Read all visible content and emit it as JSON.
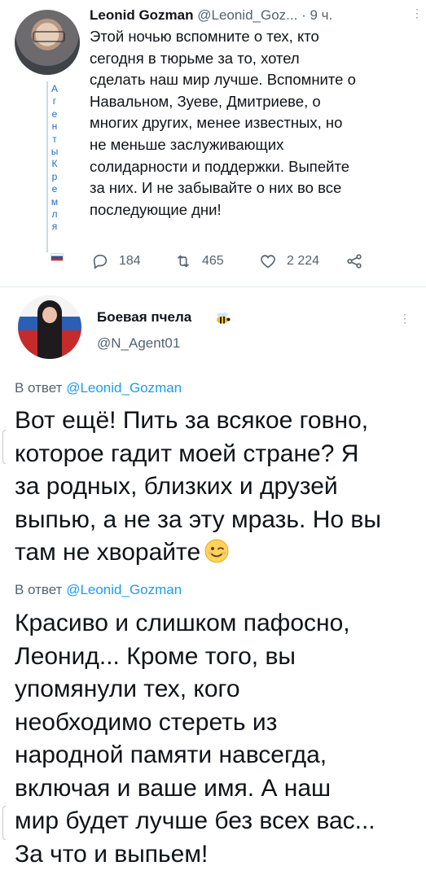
{
  "tweet1": {
    "author_name": "Leonid Gozman",
    "handle": "@Leonid_Goz...",
    "separator": "·",
    "time": "9 ч.",
    "text": "Этой ночью вспомните о тех, кто\nсегодня в тюрьме за то, хотел\nсделать наш мир лучше. Вспомните о\nНавальном, Зуеве, Дмитриеве, о\nмногих других, менее известных, но\nне меньше заслуживающих\nсолидарности и поддержки. Выпейте\nза них. И не забывайте о них во все\nпоследующие дни!",
    "side_label_letters": [
      "А",
      "г",
      "е",
      "н",
      "т",
      "ы",
      "К",
      "р",
      "е",
      "м",
      "л",
      "я"
    ],
    "replies": "184",
    "retweets": "465",
    "likes": "2 224"
  },
  "tweet2": {
    "author_name": "Боевая пчела",
    "handle": "@N_Agent01",
    "reply1_prefix": "В ответ",
    "reply1_mention": "@Leonid_Gozman",
    "reply1_text": "Вот ещё! Пить за всякое говно,\nкоторое гадит моей стране? Я\nза родных, близких и друзей\nвыпью, а не за эту мразь. Но вы\nтам не хворайте",
    "reply2_prefix": "В ответ",
    "reply2_mention": "@Leonid_Gozman",
    "reply2_text": "Красиво и слишком пафосно,\nЛеонид... Кроме того, вы\nупомянули тех, кого\nнеобходимо стереть из\nнародной памяти навсегда,\nвключая и ваше имя. А наш\nмир будет лучше без всех вас...\nЗа что и выпьем!"
  },
  "icons": {
    "reply": "reply-icon",
    "retweet": "retweet-icon",
    "like": "heart-icon",
    "share": "share-icon",
    "more": "more-vertical-icon",
    "bee": "bee-emoji-icon",
    "wink": "wink-emoji-icon",
    "flag": "russian-flag-icon"
  },
  "colors": {
    "mention": "#1d9bf0",
    "secondary_text": "#536471",
    "vertical_label": "#1d6dc6"
  }
}
